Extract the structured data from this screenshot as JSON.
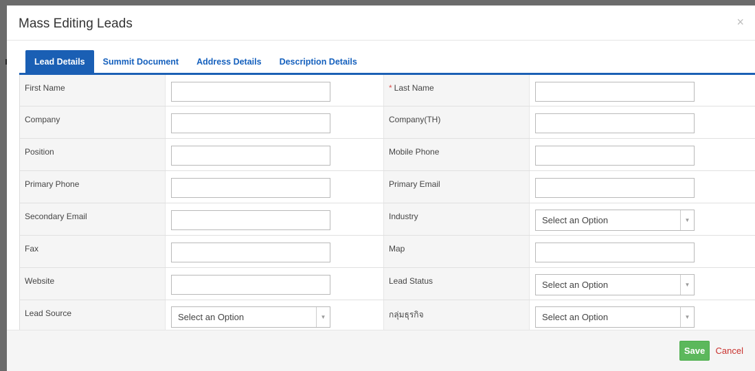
{
  "modal": {
    "title": "Mass Editing Leads",
    "close_glyph": "×",
    "close_icon": "close-icon"
  },
  "tabs": [
    {
      "label": "Lead Details",
      "active": true
    },
    {
      "label": "Summit Document",
      "active": false
    },
    {
      "label": "Address Details",
      "active": false
    },
    {
      "label": "Description Details",
      "active": false
    }
  ],
  "form": {
    "rows": [
      {
        "left": {
          "label": "First Name",
          "type": "input",
          "value": ""
        },
        "right": {
          "label": "Last Name",
          "required": true,
          "type": "input",
          "value": ""
        }
      },
      {
        "left": {
          "label": "Company",
          "type": "input",
          "value": ""
        },
        "right": {
          "label": "Company(TH)",
          "type": "input",
          "value": ""
        }
      },
      {
        "left": {
          "label": "Position",
          "type": "input",
          "value": ""
        },
        "right": {
          "label": "Mobile Phone",
          "type": "input",
          "value": ""
        }
      },
      {
        "left": {
          "label": "Primary Phone",
          "type": "input",
          "value": ""
        },
        "right": {
          "label": "Primary Email",
          "type": "input",
          "value": ""
        }
      },
      {
        "left": {
          "label": "Secondary Email",
          "type": "input",
          "value": ""
        },
        "right": {
          "label": "Industry",
          "type": "select",
          "value": "Select an Option"
        }
      },
      {
        "left": {
          "label": "Fax",
          "type": "input",
          "value": ""
        },
        "right": {
          "label": "Map",
          "type": "input",
          "value": ""
        }
      },
      {
        "left": {
          "label": "Website",
          "type": "input",
          "value": ""
        },
        "right": {
          "label": "Lead Status",
          "type": "select",
          "value": "Select an Option"
        }
      },
      {
        "left": {
          "label": "Lead Source",
          "type": "select",
          "value": "Select an Option"
        },
        "right": {
          "label": "กลุ่มธุรกิจ",
          "type": "select",
          "value": "Select an Option"
        }
      }
    ],
    "required_mark": "*",
    "select_arrow_glyph": "▼"
  },
  "footer": {
    "save_label": "Save",
    "cancel_label": "Cancel"
  },
  "colors": {
    "accent": "#1a5fb4",
    "save": "#5cb85c",
    "cancel": "#c9302c",
    "required": "#d9534f"
  }
}
